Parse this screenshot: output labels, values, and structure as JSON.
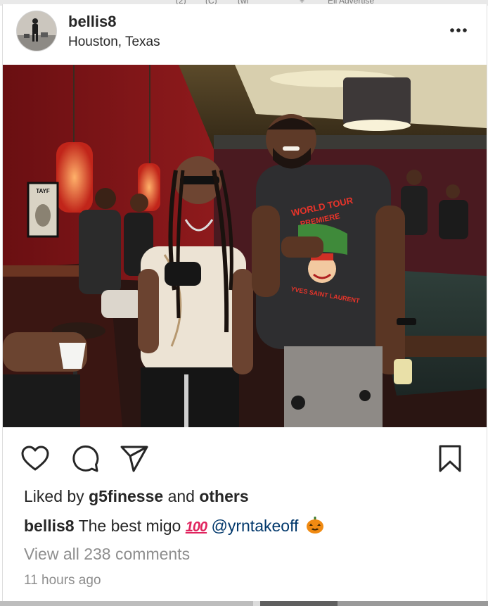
{
  "browser": {
    "tab_fragments": [
      "(2)",
      "(C)",
      "(wi",
      "",
      "+",
      "Eli Advertise"
    ]
  },
  "post": {
    "author": {
      "username": "bellis8",
      "location": "Houston, Texas",
      "avatar_icon": "profile-avatar"
    },
    "more_icon": "more-horizontal-icon",
    "photo": {
      "tshirt_text_top": "WORLD TOUR",
      "tshirt_text_mid": "PREMIERE",
      "tshirt_text_bottom": "YVES SAINT LAURENT",
      "wall_poster_text": "TAYF"
    },
    "actions": {
      "like_icon": "heart-icon",
      "comment_icon": "comment-icon",
      "share_icon": "share-icon",
      "save_icon": "bookmark-icon"
    },
    "likes": {
      "prefix": "Liked by",
      "liker": "g5finesse",
      "connector": "and",
      "others": "others"
    },
    "caption": {
      "username": "bellis8",
      "text": "The best migo",
      "emoji_100": "100",
      "mention": "@yrntakeoff",
      "emoji_pumpkin": "jack-o-lantern"
    },
    "comments_link": "View all 238 comments",
    "timestamp": "11 hours ago"
  },
  "colors": {
    "text_primary": "#262626",
    "text_secondary": "#8e8e8e",
    "mention": "#00376b",
    "hundred_emoji": "#e0245e"
  }
}
